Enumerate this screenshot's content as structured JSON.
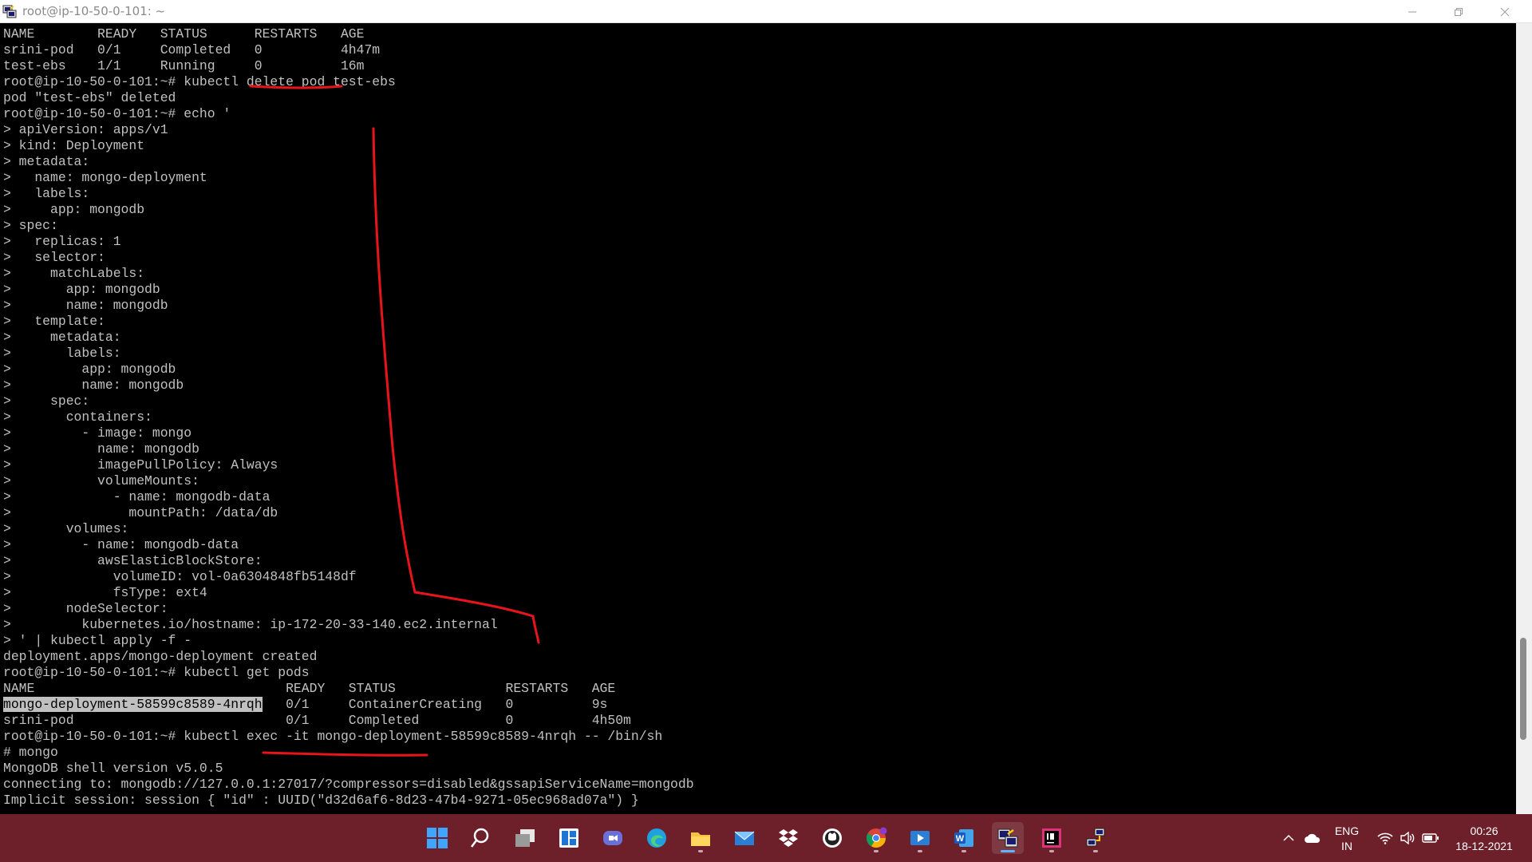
{
  "window": {
    "title": "root@ip-10-50-0-101: ~"
  },
  "terminal": {
    "lines": [
      "NAME        READY   STATUS      RESTARTS   AGE",
      "srini-pod   0/1     Completed   0          4h47m",
      "test-ebs    1/1     Running     0          16m",
      "root@ip-10-50-0-101:~# kubectl delete pod test-ebs",
      "pod \"test-ebs\" deleted",
      "root@ip-10-50-0-101:~# echo '",
      "> apiVersion: apps/v1",
      "> kind: Deployment",
      "> metadata:",
      ">   name: mongo-deployment",
      ">   labels:",
      ">     app: mongodb",
      "> spec:",
      ">   replicas: 1",
      ">   selector:",
      ">     matchLabels:",
      ">       app: mongodb",
      ">       name: mongodb",
      ">   template:",
      ">     metadata:",
      ">       labels:",
      ">         app: mongodb",
      ">         name: mongodb",
      ">     spec:",
      ">       containers:",
      ">         - image: mongo",
      ">           name: mongodb",
      ">           imagePullPolicy: Always",
      ">           volumeMounts:",
      ">             - name: mongodb-data",
      ">               mountPath: /data/db",
      ">       volumes:",
      ">         - name: mongodb-data",
      ">           awsElasticBlockStore:",
      ">             volumeID: vol-0a6304848fb5148df",
      ">             fsType: ext4",
      ">       nodeSelector:",
      ">         kubernetes.io/hostname: ip-172-20-33-140.ec2.internal",
      "> ' | kubectl apply -f -",
      "deployment.apps/mongo-deployment created",
      "root@ip-10-50-0-101:~# kubectl get pods",
      "NAME                                READY   STATUS              RESTARTS   AGE",
      "",
      "srini-pod                           0/1     Completed           0          4h50m",
      "root@ip-10-50-0-101:~# kubectl exec -it mongo-deployment-58599c8589-4nrqh -- /bin/sh",
      "# mongo",
      "MongoDB shell version v5.0.5",
      "connecting to: mongodb://127.0.0.1:27017/?compressors=disabled&gssapiServiceName=mongodb",
      "Implicit session: session { \"id\" : UUID(\"d32d6af6-8d23-47b4-9271-05ec968ad07a\") }"
    ],
    "selected_row": {
      "selected_text": "mongo-deployment-58599c8589-4nrqh",
      "rest": "   0/1     ContainerCreating   0          9s"
    }
  },
  "taskbar": {
    "apps": [
      {
        "name": "start-button",
        "icon": "windows-logo-icon"
      },
      {
        "name": "search-button",
        "icon": "search-icon"
      },
      {
        "name": "task-view-button",
        "icon": "task-view-icon"
      },
      {
        "name": "widgets-button",
        "icon": "widgets-icon"
      },
      {
        "name": "teams-chat-button",
        "icon": "teams-chat-icon"
      },
      {
        "name": "edge-button",
        "icon": "edge-icon"
      },
      {
        "name": "file-explorer-button",
        "icon": "folder-icon"
      },
      {
        "name": "mail-button",
        "icon": "mail-icon"
      },
      {
        "name": "dropbox-button",
        "icon": "dropbox-icon"
      },
      {
        "name": "github-button",
        "icon": "github-icon"
      },
      {
        "name": "chrome-button",
        "icon": "chrome-icon"
      },
      {
        "name": "media-player-button",
        "icon": "media-player-icon"
      },
      {
        "name": "word-button",
        "icon": "word-icon"
      },
      {
        "name": "putty-button",
        "icon": "putty-icon"
      },
      {
        "name": "intellij-button",
        "icon": "intellij-icon"
      },
      {
        "name": "network-tool-button",
        "icon": "network-tool-icon"
      }
    ],
    "tray": {
      "language_line1": "ENG",
      "language_line2": "IN",
      "time": "00:26",
      "date": "18-12-2021"
    }
  },
  "colors": {
    "terminal_bg": "#000000",
    "terminal_fg": "#c0c0c0",
    "annotation": "#e8141b",
    "taskbar_bg": "#6d1f2a"
  }
}
